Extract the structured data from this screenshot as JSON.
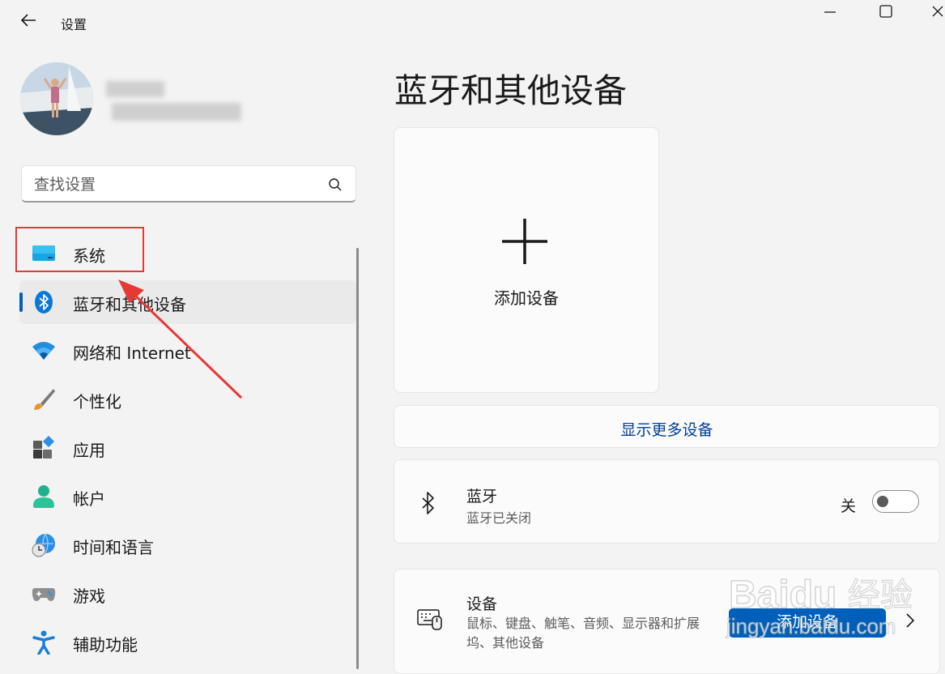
{
  "app": {
    "title": "设置"
  },
  "search": {
    "placeholder": "查找设置"
  },
  "nav": {
    "items": [
      {
        "label": "系统",
        "icon": "system-icon"
      },
      {
        "label": "蓝牙和其他设备",
        "icon": "bluetooth-icon",
        "active": true
      },
      {
        "label": "网络和 Internet",
        "icon": "wifi-icon"
      },
      {
        "label": "个性化",
        "icon": "brush-icon"
      },
      {
        "label": "应用",
        "icon": "apps-icon"
      },
      {
        "label": "帐户",
        "icon": "account-icon"
      },
      {
        "label": "时间和语言",
        "icon": "time-language-icon"
      },
      {
        "label": "游戏",
        "icon": "gamepad-icon"
      },
      {
        "label": "辅助功能",
        "icon": "accessibility-icon"
      }
    ]
  },
  "main": {
    "title": "蓝牙和其他设备",
    "add_device_card": {
      "label": "添加设备"
    },
    "show_more": {
      "label": "显示更多设备"
    },
    "bluetooth": {
      "title": "蓝牙",
      "subtitle": "蓝牙已关闭",
      "state": "关",
      "on": false
    },
    "devices": {
      "title": "设备",
      "subtitle": "鼠标、键盘、触笔、音频、显示器和扩展坞、其他设备",
      "add_button": "添加设备"
    }
  },
  "watermark": {
    "brand": "Baidu",
    "name": "经验",
    "url": "jingyan.baidu.com"
  },
  "colors": {
    "accent": "#005fb8",
    "link": "#003e92",
    "annotation": "#e53935"
  }
}
